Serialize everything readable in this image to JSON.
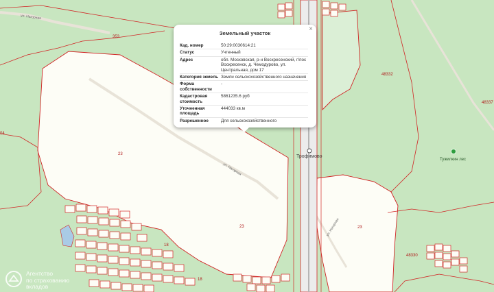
{
  "map": {
    "plot_numbers": [
      "353",
      "23",
      "23",
      "23",
      "23",
      "18",
      "18",
      "48332",
      "48337",
      "48330",
      "04"
    ],
    "road_names": [
      "ул. Нагорная",
      "ул. Нагорная",
      "ул. Нагорная"
    ],
    "station_name": "Трофимово",
    "forest_name": "Тужилкин лес",
    "colors": {
      "background": "#c8e6c0",
      "parcel_fill": "#fdfdf6",
      "parcel_border": "#d12424",
      "road": "#e8e3d8",
      "railway": "#d5d5d5",
      "water": "#a9cbe6",
      "forest_marker": "#2e9e3e"
    }
  },
  "popup": {
    "title": "Земельный участок",
    "close": "×",
    "rows": [
      {
        "key": "Кад. номер",
        "value": "50:29:0030614:21"
      },
      {
        "key": "Статус",
        "value": "Учтенный"
      },
      {
        "key": "Адрес",
        "value": "обл. Московская, р-н Воскресенский, г/пос Воскресенск, д. Чемодурово, ул. Центральная, дом 17"
      },
      {
        "key": "Категория земель",
        "value": "Земли сельскохозяйственного назначения"
      },
      {
        "key": "Форма собственности",
        "value": "-"
      },
      {
        "key": "Кадастровая стоимость",
        "value": "5861235.6 руб"
      },
      {
        "key": "Уточненная площадь",
        "value": "444033 кв.м"
      },
      {
        "key": "Разрешенное",
        "value": "Для сельскохозяйственного"
      }
    ]
  },
  "watermark": {
    "line1": "Агентство",
    "line2": "по страхованию",
    "line3": "вкладов"
  }
}
